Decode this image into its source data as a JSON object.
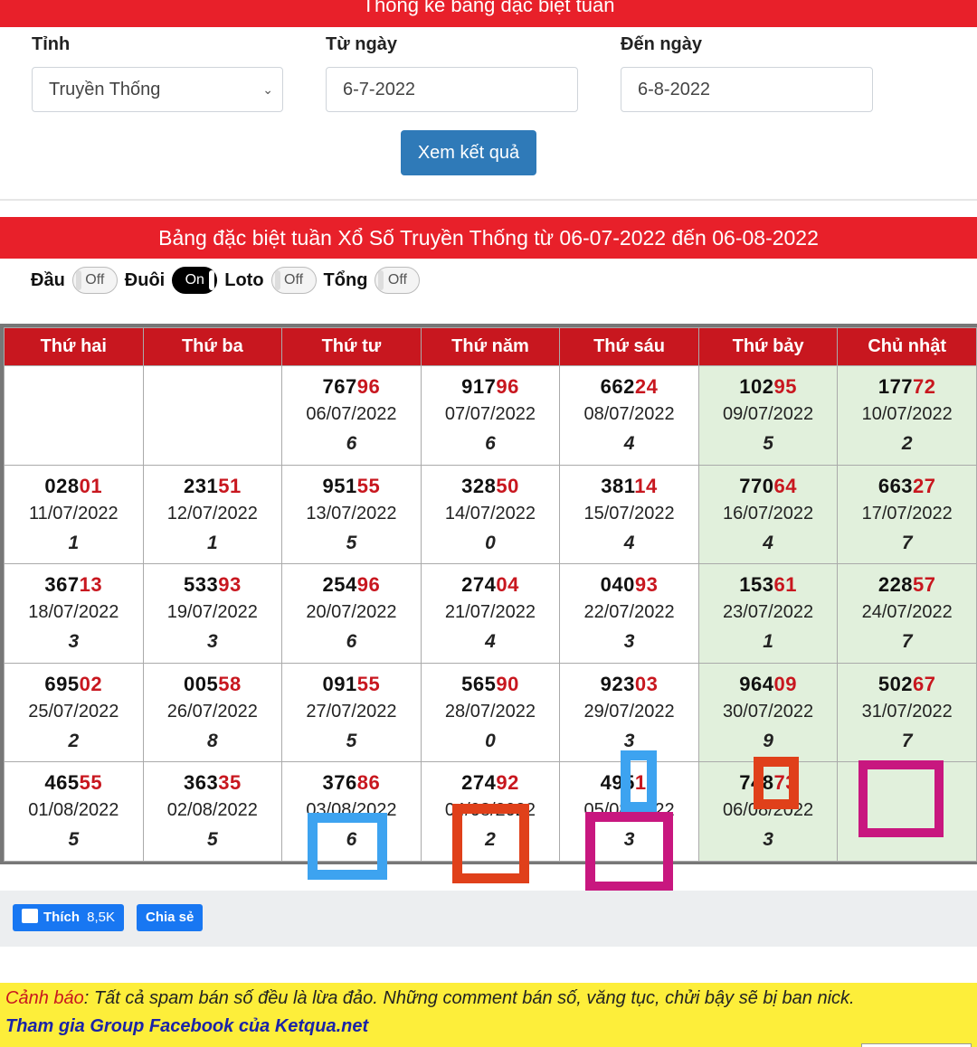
{
  "header": {
    "top_title": "Thống kê bảng đặc biệt tuần"
  },
  "form": {
    "province_label": "Tỉnh",
    "province_value": "Truyền Thống",
    "from_label": "Từ ngày",
    "from_value": "6-7-2022",
    "to_label": "Đến ngày",
    "to_value": "6-8-2022",
    "submit_label": "Xem kết quả"
  },
  "result_title": "Bảng đặc biệt tuần Xổ Số Truyền Thống từ 06-07-2022 đến 06-08-2022",
  "toggles": [
    {
      "label": "Đầu",
      "state": "Off"
    },
    {
      "label": "Đuôi",
      "state": "On"
    },
    {
      "label": "Loto",
      "state": "Off"
    },
    {
      "label": "Tổng",
      "state": "Off"
    }
  ],
  "columns": [
    "Thứ hai",
    "Thứ ba",
    "Thứ tư",
    "Thứ năm",
    "Thứ sáu",
    "Thứ bảy",
    "Chủ nhật"
  ],
  "rows": [
    [
      null,
      null,
      {
        "head": "767",
        "tail": "96",
        "date": "06/07/2022",
        "sum": "6"
      },
      {
        "head": "917",
        "tail": "96",
        "date": "07/07/2022",
        "sum": "6"
      },
      {
        "head": "662",
        "tail": "24",
        "date": "08/07/2022",
        "sum": "4"
      },
      {
        "head": "102",
        "tail": "95",
        "date": "09/07/2022",
        "sum": "5"
      },
      {
        "head": "177",
        "tail": "72",
        "date": "10/07/2022",
        "sum": "2"
      }
    ],
    [
      {
        "head": "028",
        "tail": "01",
        "date": "11/07/2022",
        "sum": "1"
      },
      {
        "head": "231",
        "tail": "51",
        "date": "12/07/2022",
        "sum": "1"
      },
      {
        "head": "951",
        "tail": "55",
        "date": "13/07/2022",
        "sum": "5"
      },
      {
        "head": "328",
        "tail": "50",
        "date": "14/07/2022",
        "sum": "0"
      },
      {
        "head": "381",
        "tail": "14",
        "date": "15/07/2022",
        "sum": "4"
      },
      {
        "head": "770",
        "tail": "64",
        "date": "16/07/2022",
        "sum": "4"
      },
      {
        "head": "663",
        "tail": "27",
        "date": "17/07/2022",
        "sum": "7"
      }
    ],
    [
      {
        "head": "367",
        "tail": "13",
        "date": "18/07/2022",
        "sum": "3"
      },
      {
        "head": "533",
        "tail": "93",
        "date": "19/07/2022",
        "sum": "3"
      },
      {
        "head": "254",
        "tail": "96",
        "date": "20/07/2022",
        "sum": "6"
      },
      {
        "head": "274",
        "tail": "04",
        "date": "21/07/2022",
        "sum": "4"
      },
      {
        "head": "040",
        "tail": "93",
        "date": "22/07/2022",
        "sum": "3"
      },
      {
        "head": "153",
        "tail": "61",
        "date": "23/07/2022",
        "sum": "1"
      },
      {
        "head": "228",
        "tail": "57",
        "date": "24/07/2022",
        "sum": "7"
      }
    ],
    [
      {
        "head": "695",
        "tail": "02",
        "date": "25/07/2022",
        "sum": "2"
      },
      {
        "head": "005",
        "tail": "58",
        "date": "26/07/2022",
        "sum": "8"
      },
      {
        "head": "091",
        "tail": "55",
        "date": "27/07/2022",
        "sum": "5"
      },
      {
        "head": "565",
        "tail": "90",
        "date": "28/07/2022",
        "sum": "0"
      },
      {
        "head": "923",
        "tail": "03",
        "date": "29/07/2022",
        "sum": "3"
      },
      {
        "head": "964",
        "tail": "09",
        "date": "30/07/2022",
        "sum": "9"
      },
      {
        "head": "502",
        "tail": "67",
        "date": "31/07/2022",
        "sum": "7"
      }
    ],
    [
      {
        "head": "465",
        "tail": "55",
        "date": "01/08/2022",
        "sum": "5"
      },
      {
        "head": "363",
        "tail": "35",
        "date": "02/08/2022",
        "sum": "5"
      },
      {
        "head": "376",
        "tail": "86",
        "date": "03/08/2022",
        "sum": "6"
      },
      {
        "head": "274",
        "tail": "92",
        "date": "04/08/2022",
        "sum": "2"
      },
      {
        "head": "495",
        "tail": "13",
        "date": "05/08/2022",
        "sum": "3"
      },
      {
        "head": "748",
        "tail": "73",
        "date": "06/08/2022",
        "sum": "3"
      },
      null
    ]
  ],
  "annotation_colors": {
    "blue": "#3da3f0",
    "orange": "#e0401a",
    "magenta": "#c8177f"
  },
  "social": {
    "like_label": "Thích",
    "like_count": "8,5K",
    "share_label": "Chia sẻ"
  },
  "warning": {
    "lead": "Cảnh báo",
    "text": ": Tất cả spam bán số đều là lừa đảo. Những comment bán số, văng tục, chửi bậy sẽ bị ban nick.",
    "group_link": "Tham gia Group Facebook của Ketqua.net"
  }
}
